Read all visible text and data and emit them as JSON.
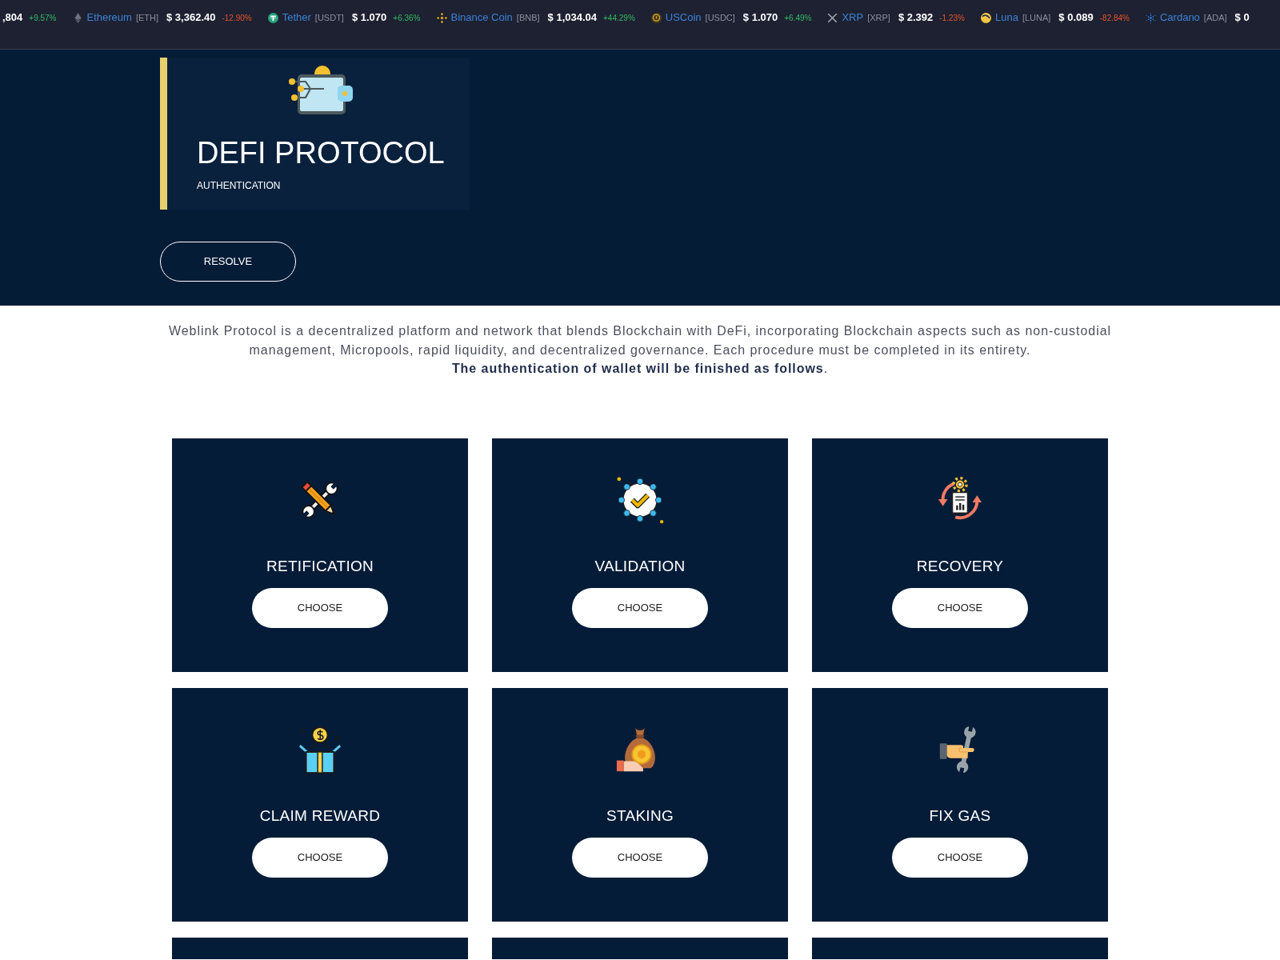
{
  "ticker": [
    {
      "price": ",804",
      "change": "+9.57%",
      "positive": true
    },
    {
      "name": "Ethereum",
      "symbol": "[ETH]",
      "price": "$ 3,362.40",
      "change": "-12.90%",
      "positive": false
    },
    {
      "name": "Tether",
      "symbol": "[USDT]",
      "price": "$ 1.070",
      "change": "+6.36%",
      "positive": true
    },
    {
      "name": "Binance Coin",
      "symbol": "[BNB]",
      "price": "$ 1,034.04",
      "change": "+44.29%",
      "positive": true
    },
    {
      "name": "USCoin",
      "symbol": "[USDC]",
      "price": "$ 1.070",
      "change": "+6.49%",
      "positive": true
    },
    {
      "name": "XRP",
      "symbol": "[XRP]",
      "price": "$ 2.392",
      "change": "-1.23%",
      "positive": false
    },
    {
      "name": "Luna",
      "symbol": "[LUNA]",
      "price": "$ 0.089",
      "change": "-82.84%",
      "positive": false
    },
    {
      "name": "Cardano",
      "symbol": "[ADA]",
      "price": "$ 0"
    }
  ],
  "header": {
    "title": "DEFI PROTOCOL",
    "subtitle": "AUTHENTICATION",
    "button": "RESOLVE"
  },
  "intro": {
    "text": "Weblink Protocol is a decentralized platform and network that blends Blockchain with DeFi, incorporating Blockchain aspects such as non-custodial management, Micropools, rapid liquidity, and decentralized governance. Each procedure must be completed in its entirety.",
    "emphasis": "**The authentication of wallet will be finished as follows**."
  },
  "cards": [
    {
      "kind": "full",
      "title": "RETIFICATION",
      "button": "CHOOSE"
    },
    {
      "kind": "full",
      "title": "VALIDATION",
      "button": "CHOOSE"
    },
    {
      "kind": "full",
      "title": "RECOVERY",
      "button": "CHOOSE"
    },
    {
      "kind": "full",
      "title": "CLAIM REWARD",
      "button": "CHOOSE"
    },
    {
      "kind": "full",
      "title": "STAKING",
      "button": "CHOOSE"
    },
    {
      "kind": "full",
      "title": "FIX GAS",
      "button": "CHOOSE"
    },
    {
      "kind": "cut-off"
    },
    {
      "kind": "cut-off"
    },
    {
      "kind": "cut-off"
    }
  ]
}
